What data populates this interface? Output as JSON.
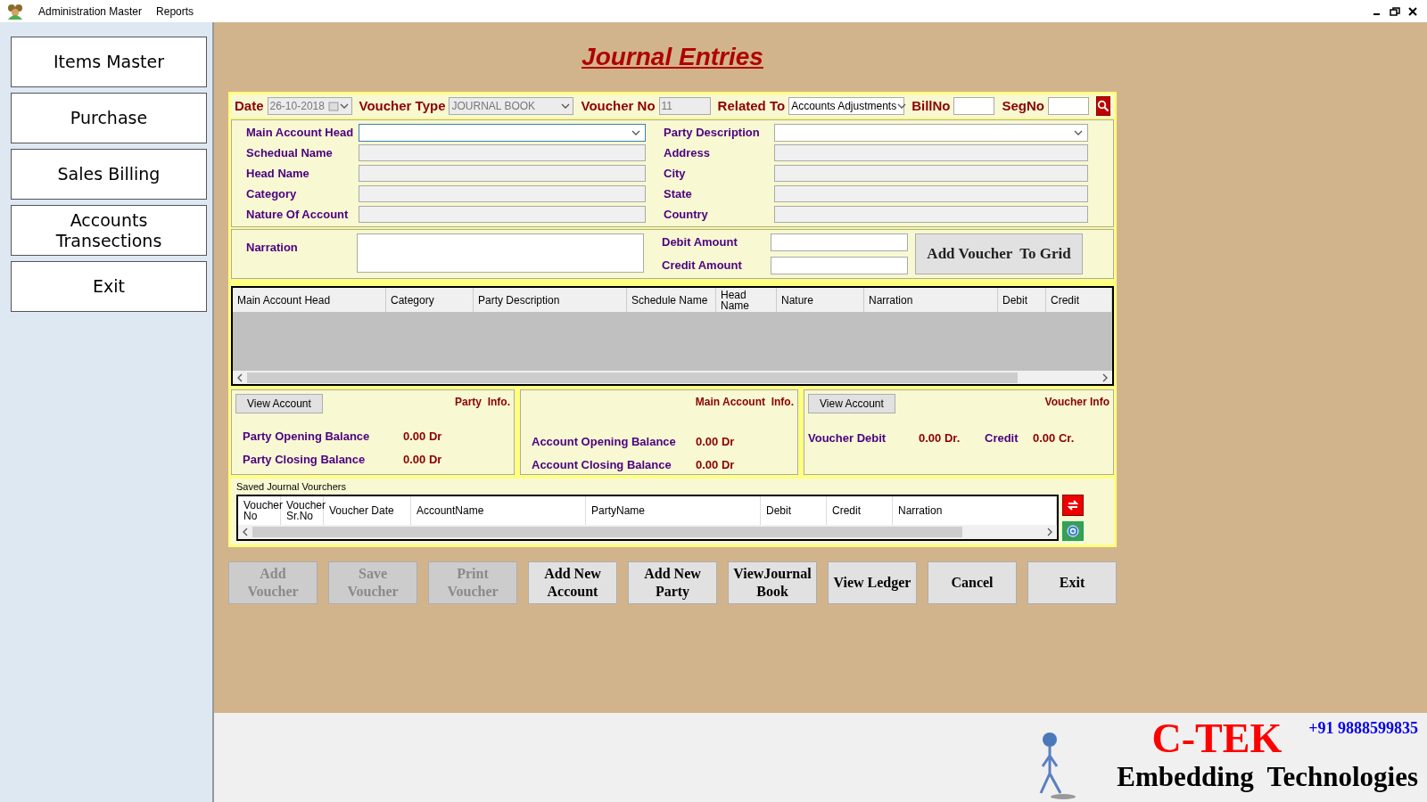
{
  "menu": [
    "Administration Master",
    "Reports"
  ],
  "sidebar": {
    "items": [
      {
        "label": "Items Master"
      },
      {
        "label": "Purchase"
      },
      {
        "label": "Sales Billing"
      },
      {
        "label": "Accounts Transections"
      },
      {
        "label": "Exit"
      }
    ]
  },
  "title": "Journal Entries",
  "header": [
    {
      "kind": "date",
      "label": "Date",
      "value": "26-10-2018",
      "disabled": true
    },
    {
      "kind": "select",
      "label": "Voucher Type",
      "value": "JOURNAL BOOK",
      "disabled": true
    },
    {
      "kind": "text",
      "label": "Voucher No",
      "value": "11",
      "disabled": true
    },
    {
      "kind": "select",
      "label": "Related To",
      "value": "Accounts Adjustments",
      "disabled": false
    },
    {
      "kind": "text",
      "label": "BillNo",
      "disabled": false
    },
    {
      "kind": "text",
      "label": "SegNo",
      "disabled": false
    }
  ],
  "account_fields": [
    {
      "label": "Main Account Head",
      "kind": "select"
    },
    {
      "label": "Schedual Name",
      "kind": "text"
    },
    {
      "label": "Head Name",
      "kind": "text"
    },
    {
      "label": "Category",
      "kind": "text"
    },
    {
      "label": "Nature Of Account",
      "kind": "text"
    }
  ],
  "party_fields": [
    {
      "label": "Party Description",
      "kind": "select"
    },
    {
      "label": "Address",
      "kind": "text"
    },
    {
      "label": "City",
      "kind": "text"
    },
    {
      "label": "State",
      "kind": "text"
    },
    {
      "label": "Country",
      "kind": "text"
    }
  ],
  "narration": {
    "label": "Narration"
  },
  "amounts": [
    {
      "label": "Debit Amount"
    },
    {
      "label": "Credit Amount"
    }
  ],
  "add_to_grid": "Add Voucher  To Grid",
  "grid": {
    "columns": [
      "Main Account Head",
      "Category",
      "Party Description",
      "Schedule Name",
      "Head Name",
      "Nature",
      "Narration",
      "Debit",
      "Credit"
    ]
  },
  "party_info": {
    "title": "Party  Info.",
    "button": "View Account",
    "rows": [
      {
        "label": "Party Opening Balance",
        "value": "0.00 Dr"
      },
      {
        "label": "Party Closing Balance",
        "value": "0.00 Dr"
      }
    ]
  },
  "main_account_info": {
    "title": "Main Account  Info.",
    "rows": [
      {
        "label": "Account Opening Balance",
        "value": "0.00 Dr"
      },
      {
        "label": "Account Closing Balance",
        "value": "0.00 Dr"
      }
    ]
  },
  "voucher_info": {
    "title": "Voucher Info",
    "button": "View Account",
    "debit_label": "Voucher Debit",
    "debit_value": "0.00 Dr.",
    "credit_label": "Credit",
    "credit_value": "0.00 Cr."
  },
  "saved": {
    "title": "Saved Journal Vourchers",
    "columns": [
      "Voucher No",
      "Voucher Sr.No",
      "Voucher Date",
      "AccountName",
      "PartyName",
      "Debit",
      "Credit",
      "Narration"
    ]
  },
  "buttons": [
    {
      "label": "Add Voucher",
      "disabled": true
    },
    {
      "label": "Save Voucher",
      "disabled": true
    },
    {
      "label": "Print Voucher",
      "disabled": true
    },
    {
      "label": "Add New Account",
      "disabled": false
    },
    {
      "label": "Add New Party",
      "disabled": false
    },
    {
      "label": "ViewJournal Book",
      "disabled": false
    },
    {
      "label": "View Ledger",
      "disabled": false
    },
    {
      "label": "Cancel",
      "disabled": false
    },
    {
      "label": "Exit",
      "disabled": false
    }
  ],
  "footer": {
    "brand": "C-TEK",
    "tagline": "Embedding  Technologies",
    "phone": "+91 9888599835"
  }
}
